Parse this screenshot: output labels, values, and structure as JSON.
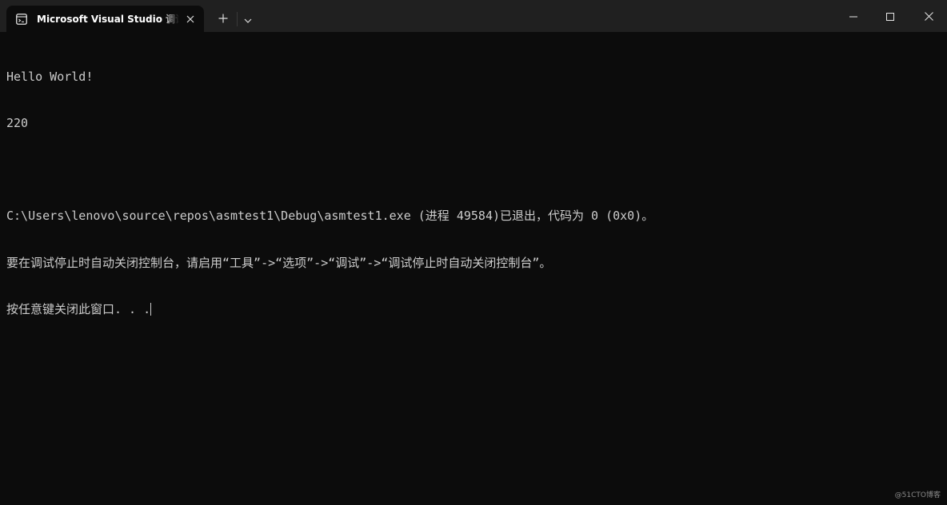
{
  "window": {
    "tab_title": "Microsoft Visual Studio 调试控制台",
    "icons": {
      "tab_icon": "terminal-icon",
      "tab_close": "close-icon",
      "new_tab": "plus-icon",
      "dropdown": "chevron-down-icon",
      "minimize": "minimize-icon",
      "maximize": "maximize-icon",
      "close": "close-icon"
    }
  },
  "console": {
    "lines": [
      "Hello World!",
      "220",
      "",
      "C:\\Users\\lenovo\\source\\repos\\asmtest1\\Debug\\asmtest1.exe (进程 49584)已退出，代码为 0 (0x0)。",
      "要在调试停止时自动关闭控制台，请启用“工具”->“选项”->“调试”->“调试停止时自动关闭控制台”。",
      "按任意键关闭此窗口. . ."
    ]
  },
  "watermark": "@51CTO博客",
  "colors": {
    "background": "#0c0c0c",
    "titlebar": "#202020",
    "text": "#cccccc"
  }
}
